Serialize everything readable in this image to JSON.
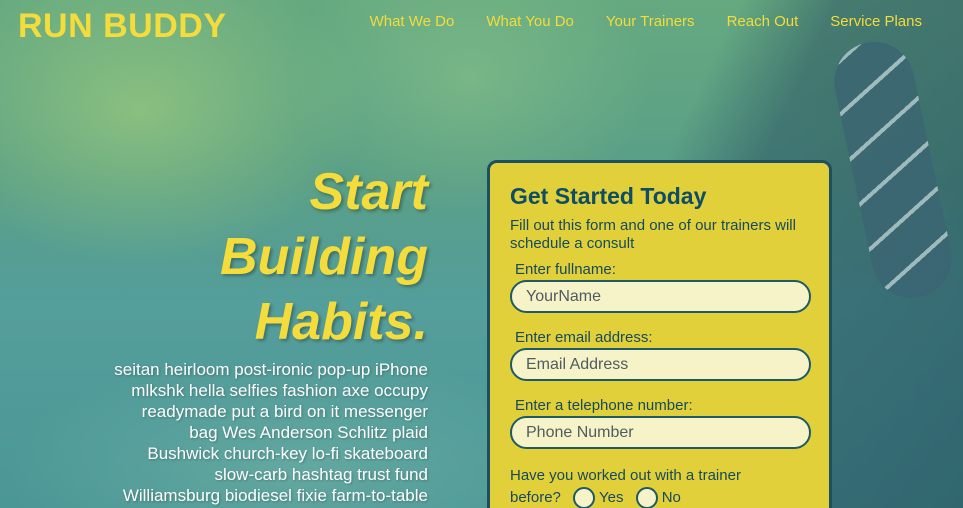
{
  "header": {
    "logo": "RUN BUDDY",
    "nav": [
      "What We Do",
      "What You Do",
      "Your Trainers",
      "Reach Out",
      "Service Plans"
    ]
  },
  "hero": {
    "headline_1": "Start",
    "headline_2": "Building",
    "headline_3": "Habits.",
    "body": "seitan heirloom post-ironic pop-up iPhone mlkshk hella selfies fashion axe occupy readymade put a bird on it messenger bag Wes Anderson Schlitz plaid Bushwick church-key lo-fi skateboard slow-carb hashtag trust fund Williamsburg biodiesel fixie farm-to-table Odd Future XOXO Bushwick"
  },
  "form": {
    "title": "Get Started Today",
    "subtitle": "Fill out this form and one of our trainers will schedule a consult",
    "name_label": "Enter fullname:",
    "name_placeholder": "YourName",
    "email_label": "Enter email address:",
    "email_placeholder": "Email Address",
    "phone_label": "Enter a telephone number:",
    "phone_placeholder": "Phone Number",
    "trainer_question_1": "Have you worked out with a trainer",
    "trainer_question_2": "before?",
    "yes_label": "Yes",
    "no_label": "No"
  },
  "colors": {
    "accent": "#f3dc3b",
    "form_bg": "#e2d03a",
    "form_border": "#1d4f63"
  }
}
